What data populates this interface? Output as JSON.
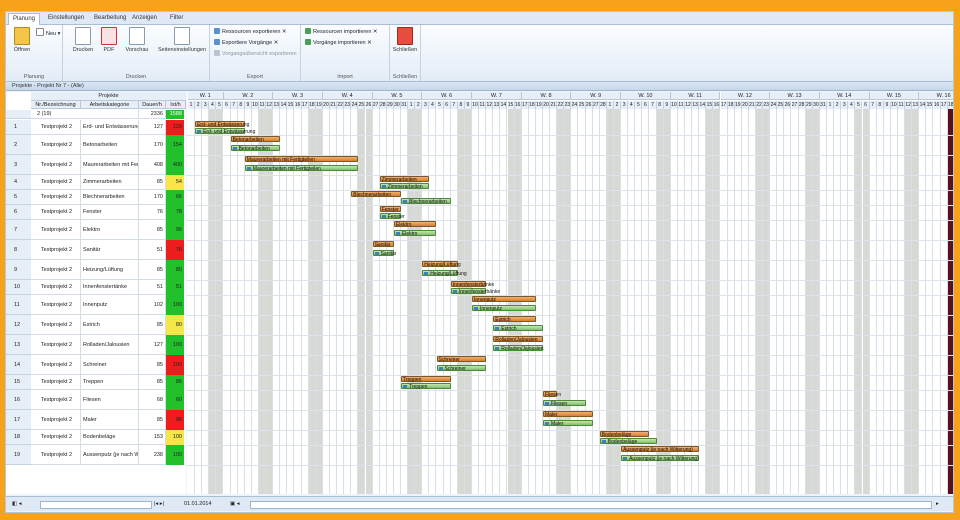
{
  "ribbon_tabs": [
    "Planung",
    "Einstellungen",
    "Bearbeitung",
    "Anzeigen",
    "Filter"
  ],
  "groups": {
    "planung": {
      "title": "Planung",
      "open_label": "Öffnen",
      "new_label": "Neu"
    },
    "drucken": {
      "title": "Drucken",
      "buttons": [
        "Drucken",
        "PDF",
        "Vorschau",
        "Seiteneinstellungen"
      ]
    },
    "export": {
      "title": "Export",
      "items": [
        "Ressourcen exportieren",
        "Exportiere Vorgänge",
        "Vorgangsübersicht exportieren"
      ]
    },
    "import": {
      "title": "Import",
      "items": [
        "Ressourcen importieren",
        "Vorgänge importieren"
      ]
    },
    "schliessen": {
      "title": "Schließen",
      "button": "Schließen"
    }
  },
  "panel_title": "Projekte - Projekt Nr 7 - (Alle)",
  "table": {
    "group_header": "Projekte",
    "columns": [
      "Nr./Bezeichnung",
      "Arbeitskategorie",
      "Dauer/h",
      "Ist/h"
    ],
    "summary": {
      "label": "2 (19)",
      "dauer": "2336",
      "ist": "1588"
    },
    "rows": [
      {
        "n": "1",
        "bez": "Testprojekt 2",
        "kat": "Erd- und Entwässerung",
        "dauer": "127",
        "ist": "129",
        "color": "#ee1c1c"
      },
      {
        "n": "2",
        "bez": "Testprojekt 2",
        "kat": "Betonarbeiten",
        "dauer": "170",
        "ist": "154",
        "color": "#22c02a"
      },
      {
        "n": "3",
        "bez": "Testprojekt 2",
        "kat": "Maurerarbeiten mit Fertigteilen",
        "dauer": "408",
        "ist": "400",
        "color": "#22c02a"
      },
      {
        "n": "4",
        "bez": "Testprojekt 2",
        "kat": "Zimmerarbeiten",
        "dauer": "85",
        "ist": "54",
        "color": "#f5e64a"
      },
      {
        "n": "5",
        "bez": "Testprojekt 2",
        "kat": "Blechnerarbeiten",
        "dauer": "170",
        "ist": "66",
        "color": "#22c02a"
      },
      {
        "n": "6",
        "bez": "Testprojekt 2",
        "kat": "Fenster",
        "dauer": "76",
        "ist": "78",
        "color": "#22c02a"
      },
      {
        "n": "7",
        "bez": "Testprojekt 2",
        "kat": "Elektro",
        "dauer": "85",
        "ist": "96",
        "color": "#22c02a"
      },
      {
        "n": "8",
        "bez": "Testprojekt 2",
        "kat": "Sanitär",
        "dauer": "51",
        "ist": "76",
        "color": "#ee1c1c"
      },
      {
        "n": "9",
        "bez": "Testprojekt 2",
        "kat": "Heizung/Lüftung",
        "dauer": "85",
        "ist": "80",
        "color": "#22c02a"
      },
      {
        "n": "10",
        "bez": "Testprojekt 2",
        "kat": "Innenfenstertänke",
        "dauer": "51",
        "ist": "51",
        "color": "#22c02a"
      },
      {
        "n": "11",
        "bez": "Testprojekt 2",
        "kat": "Innenputz",
        "dauer": "102",
        "ist": "100",
        "color": "#22c02a"
      },
      {
        "n": "12",
        "bez": "Testprojekt 2",
        "kat": "Estrich",
        "dauer": "85",
        "ist": "80",
        "color": "#f5e64a"
      },
      {
        "n": "13",
        "bez": "Testprojekt 2",
        "kat": "Rolladen/Jalousien",
        "dauer": "127",
        "ist": "100",
        "color": "#22c02a"
      },
      {
        "n": "14",
        "bez": "Testprojekt 2",
        "kat": "Schreiner",
        "dauer": "85",
        "ist": "100",
        "color": "#ee1c1c"
      },
      {
        "n": "15",
        "bez": "Testprojekt 2",
        "kat": "Treppen",
        "dauer": "85",
        "ist": "86",
        "color": "#22c02a"
      },
      {
        "n": "16",
        "bez": "Testprojekt 2",
        "kat": "Fliesen",
        "dauer": "68",
        "ist": "60",
        "color": "#22c02a"
      },
      {
        "n": "17",
        "bez": "Testprojekt 2",
        "kat": "Maler",
        "dauer": "85",
        "ist": "96",
        "color": "#ee1c1c"
      },
      {
        "n": "18",
        "bez": "Testprojekt 2",
        "kat": "Bodenbeläge",
        "dauer": "153",
        "ist": "100",
        "color": "#f5e64a"
      },
      {
        "n": "19",
        "bez": "Testprojekt 2",
        "kat": "Aussenputz (je nach Witterung)",
        "dauer": "238",
        "ist": "100",
        "color": "#22c02a"
      }
    ]
  },
  "weeks": [
    "W. 1",
    "W. 2",
    "W. 3",
    "W. 4",
    "W. 5",
    "W. 6",
    "W. 7",
    "W. 8",
    "W. 9",
    "W. 10",
    "W. 11",
    "W. 12",
    "W. 13",
    "W. 14",
    "W. 15",
    "W. 16"
  ],
  "days": [
    "1",
    "2",
    "3",
    "4",
    "5",
    "6",
    "7",
    "8",
    "9",
    "10",
    "11",
    "12",
    "13",
    "14",
    "15",
    "16",
    "17",
    "18",
    "19",
    "20",
    "21",
    "22",
    "23",
    "24",
    "25",
    "26",
    "27",
    "28",
    "29",
    "30",
    "31",
    "1",
    "2",
    "3",
    "4",
    "5",
    "6",
    "7",
    "8",
    "9",
    "10",
    "11",
    "12",
    "13",
    "14",
    "15",
    "16",
    "17",
    "18",
    "19",
    "20",
    "21",
    "22",
    "23",
    "24",
    "25",
    "26",
    "27",
    "28",
    "1",
    "2",
    "3",
    "4",
    "5",
    "6",
    "7",
    "8",
    "9",
    "10",
    "11",
    "12",
    "13",
    "14",
    "15",
    "16",
    "17",
    "18",
    "19",
    "20",
    "21",
    "22",
    "23",
    "24",
    "25",
    "26",
    "27",
    "28",
    "29",
    "30",
    "31",
    "1",
    "2",
    "3",
    "4",
    "5",
    "6",
    "7",
    "8",
    "9",
    "10",
    "11",
    "12",
    "13",
    "14",
    "15",
    "16",
    "17",
    "18",
    "19"
  ],
  "bars": [
    {
      "row": 1,
      "start": 1,
      "len": 7,
      "plan": "Erd- und Entwässerung",
      "ist": "Erd- und Entwässerung",
      "istlen": 7
    },
    {
      "row": 2,
      "start": 6,
      "len": 7,
      "plan": "Betonarbeiten",
      "ist": "Betonarbeiten",
      "istlen": 7
    },
    {
      "row": 3,
      "start": 8,
      "len": 16,
      "plan": "Maurerarbeiten mit Fertigteilen",
      "ist": "Maurerarbeiten mit Fertigteilen",
      "istlen": 16
    },
    {
      "row": 4,
      "start": 27,
      "len": 7,
      "plan": "Zimmerarbeiten",
      "ist": "Zimmerarbeiten",
      "istlen": 7
    },
    {
      "row": 5,
      "start": 23,
      "len": 7,
      "plan": "Blechnerarbeiten",
      "ist": "Blechnerarbeiten",
      "istlen": 7,
      "iststart": 30
    },
    {
      "row": 6,
      "start": 27,
      "len": 3,
      "plan": "Fenster",
      "ist": "Fenster",
      "istlen": 3
    },
    {
      "row": 7,
      "start": 29,
      "len": 6,
      "plan": "Elektro",
      "ist": "Elektro",
      "istlen": 6
    },
    {
      "row": 8,
      "start": 26,
      "len": 3,
      "plan": "Sanitär",
      "ist": "Sanitär",
      "istlen": 3
    },
    {
      "row": 9,
      "start": 33,
      "len": 5,
      "plan": "Heizung/Lüftung",
      "ist": "Heizung/Lüftung",
      "istlen": 5
    },
    {
      "row": 10,
      "start": 37,
      "len": 5,
      "plan": "Innenfensterbänke",
      "ist": "Innenfensterbänke",
      "istlen": 5
    },
    {
      "row": 11,
      "start": 40,
      "len": 9,
      "plan": "Innenputz",
      "ist": "Innenputz",
      "istlen": 9
    },
    {
      "row": 12,
      "start": 43,
      "len": 6,
      "plan": "Estrich",
      "ist": "Estrich",
      "istlen": 7
    },
    {
      "row": 13,
      "start": 43,
      "len": 7,
      "plan": "Rolladen/Jalousien",
      "ist": "Rolladen/Jalousien",
      "istlen": 7
    },
    {
      "row": 14,
      "start": 35,
      "len": 7,
      "plan": "Schreiner",
      "ist": "Schreiner",
      "istlen": 7
    },
    {
      "row": 15,
      "start": 30,
      "len": 7,
      "plan": "Treppen",
      "ist": "Treppen",
      "istlen": 7
    },
    {
      "row": 16,
      "start": 50,
      "len": 2,
      "plan": "Fliesen",
      "ist": "Fliesen",
      "istlen": 6
    },
    {
      "row": 17,
      "start": 50,
      "len": 7,
      "plan": "Maler",
      "ist": "Maler",
      "istlen": 7
    },
    {
      "row": 18,
      "start": 58,
      "len": 7,
      "plan": "Bodenbeläge",
      "ist": "Bodenbeläge",
      "istlen": 8
    },
    {
      "row": 19,
      "start": 61,
      "len": 11,
      "plan": "Aussenputz (je nach Witterung)",
      "ist": "Aussenputz (je nach Witterung)",
      "istlen": 11
    }
  ],
  "status": {
    "date": "01.01.2014"
  }
}
